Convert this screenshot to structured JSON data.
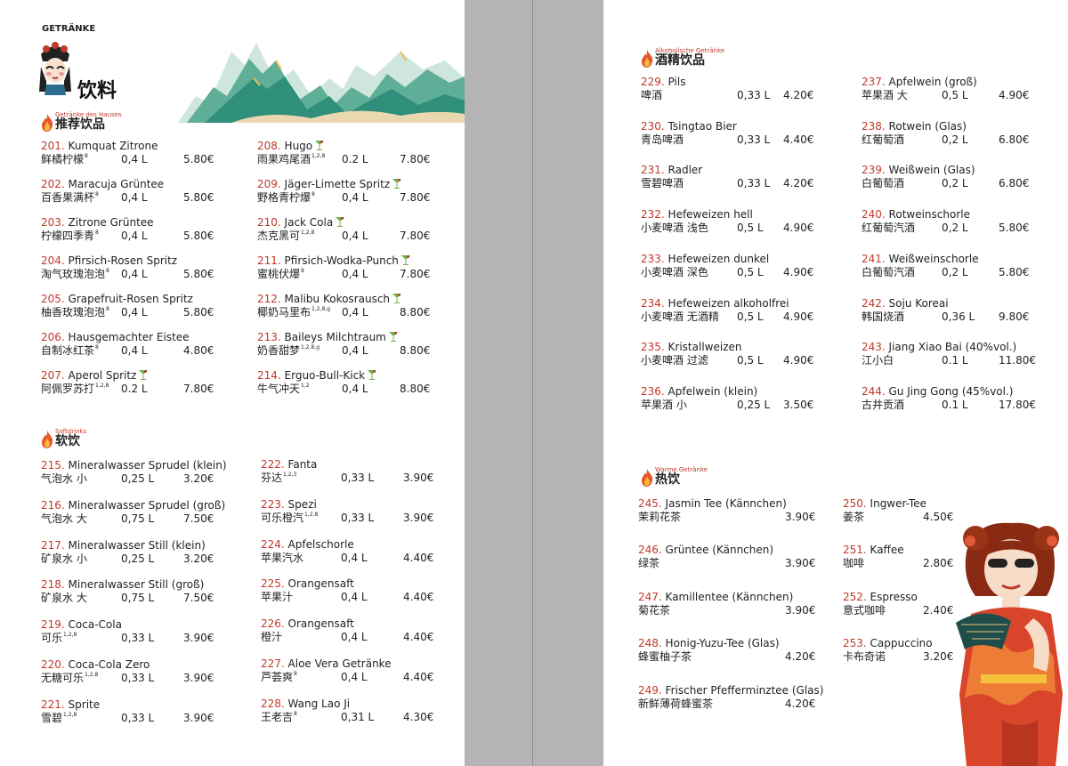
{
  "header": {
    "title_de": "GETRÄNKE",
    "title_zh": "饮料"
  },
  "sections": {
    "haus": {
      "de": "Getränke des Hauses",
      "zh": "推荐饮品"
    },
    "soft": {
      "de": "Softdrinks",
      "zh": "软饮"
    },
    "alk": {
      "de": "Alkoholische Getränke",
      "zh": "酒精饮品"
    },
    "warm": {
      "de": "Warme Getränke",
      "zh": "热饮"
    }
  },
  "icons": {
    "section": "flame-icon",
    "cocktail": "cocktail-glass-icon",
    "logo": "opera-mask-icon",
    "decor": "mountains-illustration",
    "figure": "qipao-woman-illustration"
  },
  "colors": {
    "accent": "#c0392b",
    "spine": "#b4b4b4",
    "mountain": "#2f8f7a"
  },
  "house_left": [
    {
      "num": "201.",
      "name": "Kumquat Zitrone",
      "zh": "鲜橘柠檬",
      "sup": "8",
      "vol": "0,4 L",
      "price": "5.80€"
    },
    {
      "num": "202.",
      "name": "Maracuja Grüntee",
      "zh": "百香果满杯",
      "sup": "8",
      "vol": "0,4 L",
      "price": "5.80€"
    },
    {
      "num": "203.",
      "name": "Zitrone Grüntee",
      "zh": "柠檬四季青",
      "sup": "8",
      "vol": "0,4 L",
      "price": "5.80€"
    },
    {
      "num": "204.",
      "name": "Pfirsich-Rosen Spritz",
      "zh": "淘气玫瑰泡泡",
      "sup": "8",
      "vol": "0,4 L",
      "price": "5.80€"
    },
    {
      "num": "205.",
      "name": "Grapefruit-Rosen Spritz",
      "zh": "柚香玫瑰泡泡",
      "sup": "8",
      "vol": "0,4 L",
      "price": "5.80€"
    },
    {
      "num": "206.",
      "name": "Hausgemachter Eistee",
      "zh": "自制冰红茶",
      "sup": "8",
      "vol": "0,4 L",
      "price": "4.80€"
    },
    {
      "num": "207.",
      "name": "Aperol Spritz",
      "zh": "阿佩罗苏打",
      "sup": "1,2,8",
      "vol": "0.2 L",
      "price": "7.80€",
      "glass": true
    }
  ],
  "house_right": [
    {
      "num": "208.",
      "name": "Hugo",
      "zh": "雨果鸡尾酒",
      "sup": "1,2,8",
      "vol": "0.2 L",
      "price": "7.80€",
      "glass": true
    },
    {
      "num": "209.",
      "name": "Jäger-Limette Spritz",
      "zh": "野格青柠爆",
      "sup": "8",
      "vol": "0,4 L",
      "price": "7.80€",
      "glass": true
    },
    {
      "num": "210.",
      "name": "Jack Cola",
      "zh": "杰克黑可",
      "sup": "1,2,8",
      "vol": "0,4 L",
      "price": "7.80€",
      "glass": true
    },
    {
      "num": "211.",
      "name": "Pfirsich-Wodka-Punch",
      "zh": "蜜桃伏爆",
      "sup": "8",
      "vol": "0,4 L",
      "price": "7.80€",
      "glass": true
    },
    {
      "num": "212.",
      "name": "Malibu Kokosrausch",
      "zh": "椰奶马里布",
      "sup": "1,2,8,g",
      "vol": "0,4 L",
      "price": "8.80€",
      "glass": true
    },
    {
      "num": "213.",
      "name": "Baileys Milchtraum",
      "zh": "奶香甜梦",
      "sup": "1,2,8,g",
      "vol": "0,4 L",
      "price": "8.80€",
      "glass": true
    },
    {
      "num": "214.",
      "name": "Erguo-Bull-Kick",
      "zh": "牛气冲天",
      "sup": "1,2",
      "vol": "0,4 L",
      "price": "8.80€",
      "glass": true
    }
  ],
  "soft_left": [
    {
      "num": "215.",
      "name": "Mineralwasser Sprudel (klein)",
      "zh": "气泡水 小",
      "vol": "0,25 L",
      "price": "3.20€"
    },
    {
      "num": "216.",
      "name": "Mineralwasser Sprudel (groß)",
      "zh": "气泡水 大",
      "vol": "0,75 L",
      "price": "7.50€"
    },
    {
      "num": "217.",
      "name": "Mineralwasser Still (klein)",
      "zh": "矿泉水 小",
      "vol": "0,25 L",
      "price": "3.20€"
    },
    {
      "num": "218.",
      "name": "Mineralwasser Still (groß)",
      "zh": "矿泉水 大",
      "vol": "0,75 L",
      "price": "7.50€"
    },
    {
      "num": "219.",
      "name": "Coca-Cola",
      "zh": "可乐",
      "sup": "1,2,8",
      "vol": "0,33 L",
      "price": "3.90€"
    },
    {
      "num": "220.",
      "name": "Coca-Cola Zero",
      "zh": "无糖可乐",
      "sup": "1,2,8",
      "vol": "0,33 L",
      "price": "3.90€"
    },
    {
      "num": "221.",
      "name": "Sprite",
      "zh": "雪碧",
      "sup": "1,2,8",
      "vol": "0,33 L",
      "price": "3.90€"
    }
  ],
  "soft_right": [
    {
      "num": "222.",
      "name": "Fanta",
      "zh": "芬达",
      "sup": "1,2,3",
      "vol": "0,33 L",
      "price": "3.90€"
    },
    {
      "num": "223.",
      "name": "Spezi",
      "zh": "可乐橙汽",
      "sup": "1,2,8",
      "vol": "0,33 L",
      "price": "3.90€"
    },
    {
      "num": "224.",
      "name": "Apfelschorle",
      "zh": "苹果汽水",
      "vol": "0,4 L",
      "price": "4.40€"
    },
    {
      "num": "225.",
      "name": "Orangensaft",
      "zh": "苹果汁",
      "vol": "0,4 L",
      "price": "4.40€"
    },
    {
      "num": "226.",
      "name": "Orangensaft",
      "zh": "橙汁",
      "vol": "0,4 L",
      "price": "4.40€"
    },
    {
      "num": "227.",
      "name": "Aloe Vera Getränke",
      "zh": "芦荟爽",
      "sup": "8",
      "vol": "0,4 L",
      "price": "4.40€"
    },
    {
      "num": "228.",
      "name": "Wang Lao Ji",
      "zh": "王老吉",
      "sup": "8",
      "vol": "0,31 L",
      "price": "4.30€"
    }
  ],
  "alk_left": [
    {
      "num": "229.",
      "name": "Pils",
      "zh": "啤酒",
      "vol": "0,33 L",
      "price": "4.20€"
    },
    {
      "num": "230.",
      "name": "Tsingtao Bier",
      "zh": "青岛啤酒",
      "vol": "0,33 L",
      "price": "4.40€"
    },
    {
      "num": "231.",
      "name": "Radler",
      "zh": "雪碧啤酒",
      "vol": "0,33 L",
      "price": "4.20€"
    },
    {
      "num": "232.",
      "name": "Hefeweizen hell",
      "zh": "小麦啤酒 浅色",
      "vol": "0,5 L",
      "price": "4.90€"
    },
    {
      "num": "233.",
      "name": "Hefeweizen dunkel",
      "zh": "小麦啤酒 深色",
      "vol": "0,5 L",
      "price": "4.90€"
    },
    {
      "num": "234.",
      "name": "Hefeweizen alkoholfrei",
      "zh": "小麦啤酒 无酒精",
      "vol": "0,5 L",
      "price": "4.90€"
    },
    {
      "num": "235.",
      "name": "Kristallweizen",
      "zh": "小麦啤酒 过滤",
      "vol": "0,5 L",
      "price": "4.90€"
    },
    {
      "num": "236.",
      "name": "Apfelwein (klein)",
      "zh": "苹果酒 小",
      "vol": "0,25 L",
      "price": "3.50€"
    }
  ],
  "alk_right": [
    {
      "num": "237.",
      "name": "Apfelwein (groß)",
      "zh": "苹果酒 大",
      "vol": "0,5 L",
      "price": "4.90€"
    },
    {
      "num": "238.",
      "name": "Rotwein (Glas)",
      "zh": "红葡萄酒",
      "vol": "0,2 L",
      "price": "6.80€"
    },
    {
      "num": "239.",
      "name": "Weißwein (Glas)",
      "zh": "白葡萄酒",
      "vol": "0,2 L",
      "price": "6.80€"
    },
    {
      "num": "240.",
      "name": "Rotweinschorle",
      "zh": "红葡萄汽酒",
      "vol": "0,2 L",
      "price": "5.80€"
    },
    {
      "num": "241.",
      "name": "Weißweinschorle",
      "zh": "白葡萄汽酒",
      "vol": "0,2 L",
      "price": "5.80€"
    },
    {
      "num": "242.",
      "name": "Soju Koreai",
      "zh": "韩国烧酒",
      "vol": "0,36 L",
      "price": "9.80€"
    },
    {
      "num": "243.",
      "name": "Jiang Xiao Bai (40%vol.)",
      "zh": "江小白",
      "vol": "0.1 L",
      "price": "11.80€"
    },
    {
      "num": "244.",
      "name": "Gu Jing Gong (45%vol.)",
      "zh": "古井贡酒",
      "vol": "0.1 L",
      "price": "17.80€"
    }
  ],
  "warm_left": [
    {
      "num": "245.",
      "name": "Jasmin Tee (Kännchen)",
      "zh": "茉莉花茶",
      "price": "3.90€"
    },
    {
      "num": "246.",
      "name": "Grüntee (Kännchen)",
      "zh": "绿茶",
      "price": "3.90€"
    },
    {
      "num": "247.",
      "name": "Kamillentee (Kännchen)",
      "zh": "菊花茶",
      "price": "3.90€"
    },
    {
      "num": "248.",
      "name": "Honig-Yuzu-Tee (Glas)",
      "zh": "蜂蜜柚子茶",
      "price": "4.20€"
    },
    {
      "num": "249.",
      "name": "Frischer Pfefferminztee (Glas)",
      "zh": "新鲜薄荷蜂蜜茶",
      "price": "4.20€"
    }
  ],
  "warm_right": [
    {
      "num": "250.",
      "name": "Ingwer-Tee",
      "zh": "姜茶",
      "price": "4.50€"
    },
    {
      "num": "251.",
      "name": "Kaffee",
      "zh": "咖啡",
      "price": "2.80€"
    },
    {
      "num": "252.",
      "name": "Espresso",
      "zh": "意式咖啡",
      "price": "2.40€"
    },
    {
      "num": "253.",
      "name": "Cappuccino",
      "zh": "卡布奇诺",
      "price": "3.20€"
    }
  ]
}
